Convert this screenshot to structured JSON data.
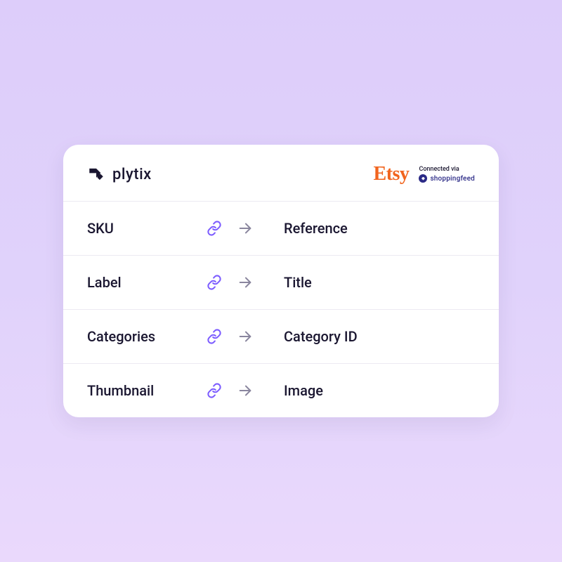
{
  "header": {
    "source_brand": "plytix",
    "target_brand": "Etsy",
    "connected_label": "Connected via",
    "connector_brand": "shoppingfeed"
  },
  "mappings": [
    {
      "source": "SKU",
      "target": "Reference"
    },
    {
      "source": "Label",
      "target": "Title"
    },
    {
      "source": "Categories",
      "target": "Category ID"
    },
    {
      "source": "Thumbnail",
      "target": "Image"
    }
  ]
}
